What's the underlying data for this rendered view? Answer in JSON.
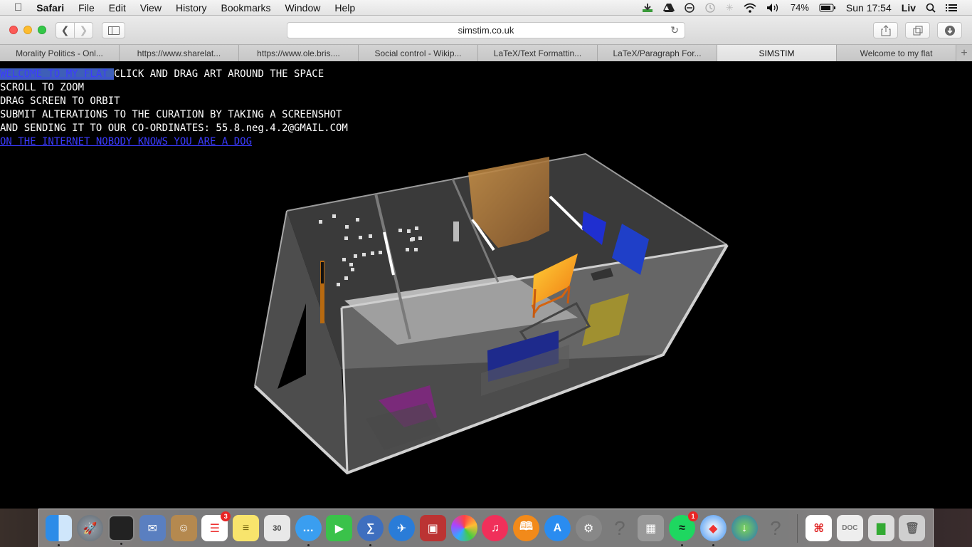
{
  "menubar": {
    "app": "Safari",
    "items": [
      "File",
      "Edit",
      "View",
      "History",
      "Bookmarks",
      "Window",
      "Help"
    ],
    "battery": "74%",
    "clock": "Sun 17:54",
    "user": "Liv"
  },
  "browser": {
    "url": "simstim.co.uk",
    "tabs": [
      {
        "label": "Morality Politics - Onl..."
      },
      {
        "label": "https://www.sharelat..."
      },
      {
        "label": "https://www.ole.bris...."
      },
      {
        "label": "Social control - Wikip..."
      },
      {
        "label": "LaTeX/Text Formattin..."
      },
      {
        "label": "LaTeX/Paragraph For..."
      },
      {
        "label": "SIMSTIM"
      },
      {
        "label": "Welcome to my flat"
      }
    ]
  },
  "page": {
    "welcome_link": "WELCOME TO MY FLAT ",
    "line1": "CLICK AND DRAG ART AROUND THE SPACE",
    "line2": "SCROLL TO ZOOM",
    "line3": "DRAG SCREEN TO ORBIT",
    "line4": "SUBMIT ALTERATIONS TO THE CURATION BY TAKING A SCREENSHOT",
    "line5": "AND SENDING IT TO OUR CO-ORDINATES: 55.8.neg.4.2@GMAIL.COM",
    "dog_link": "ON THE INTERNET NOBODY KNOWS YOU ARE A DOG"
  },
  "dock": {
    "reminders_badge": "3",
    "spotify_badge": "1",
    "calendar_day": "30"
  }
}
